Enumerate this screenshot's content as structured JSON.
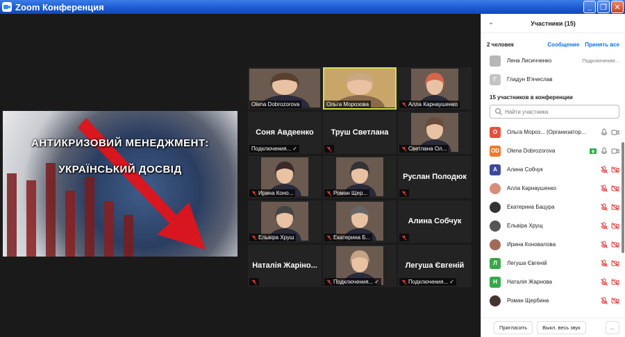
{
  "window": {
    "title": "Zoom Конференция"
  },
  "slide": {
    "line1": "АНТИКРИЗОВИЙ МЕНЕДЖМЕНТ:",
    "line2": "УКРАЇНСЬКИЙ ДОСВІД"
  },
  "tiles": [
    {
      "label": "Olena Dobrozorova",
      "photo": true,
      "mic_off": false,
      "check": false,
      "active": false
    },
    {
      "label": "Ольга Морозова",
      "photo": true,
      "mic_off": false,
      "check": false,
      "active": true
    },
    {
      "label": "Алла Карнаушенко",
      "photo": true,
      "mic_off": true,
      "check": false,
      "active": false
    },
    {
      "label": "Соня Авдеенко",
      "sub": "Подключения...",
      "photo": false,
      "mic_off": false,
      "check": true
    },
    {
      "label": "Труш Светлана",
      "photo": false,
      "mic_off": true,
      "check": false
    },
    {
      "label": "Светлана Ол...",
      "photo": true,
      "mic_off": true,
      "check": false
    },
    {
      "label": "Ирина Коно...",
      "photo": true,
      "mic_off": true,
      "check": false
    },
    {
      "label": "Роман Щер...",
      "photo": true,
      "mic_off": true,
      "check": false
    },
    {
      "label": "Руслан Полодюк",
      "photo": false,
      "mic_off": true,
      "check": false
    },
    {
      "label": "Ельвіра Хруш",
      "photo": true,
      "mic_off": true,
      "check": false
    },
    {
      "label": "Екатерина Б...",
      "photo": true,
      "mic_off": true,
      "check": false
    },
    {
      "label": "Алина Собчук",
      "photo": false,
      "mic_off": true,
      "check": false
    },
    {
      "label": "Наталія Жаріно...",
      "photo": false,
      "mic_off": true,
      "check": false
    },
    {
      "label": "Подключения...",
      "photo": true,
      "mic_off": true,
      "check": true
    },
    {
      "label": "Легуша Євгеній",
      "sub": "Подключения...",
      "photo": false,
      "mic_off": true,
      "check": true
    }
  ],
  "panel": {
    "title": "Участники (15)",
    "waiting_count": "2 человек",
    "message_label": "Сообщение",
    "admit_all_label": "Принять все",
    "waiting": [
      {
        "name": "Лена Лисичченко",
        "note": "Подключение...",
        "color": "#b7b7b7",
        "initial": ""
      },
      {
        "name": "Гладун В'ячеслав",
        "note": "",
        "color": "#c4c4c4",
        "initial": "Г"
      }
    ],
    "in_meeting_title": "15 участников в конференции",
    "search_placeholder": "Найти участника",
    "participants": [
      {
        "name": "Ольга Мороз... (Организатор...",
        "initial": "О",
        "color": "#e3503e",
        "mic": "on",
        "cam": "on"
      },
      {
        "name": "Olena Dobrozorova",
        "initial": "OD",
        "color": "#f07a2a",
        "mic": "on",
        "cam": "on",
        "share": true
      },
      {
        "name": "Алина Собчук",
        "initial": "А",
        "color": "#3b4a9c",
        "mic": "off",
        "cam": "off"
      },
      {
        "name": "Алла Карнаушенко",
        "initial": "",
        "color": "#d88c7a",
        "mic": "off",
        "cam": "off"
      },
      {
        "name": "Екатерина Бацура",
        "initial": "",
        "color": "#333333",
        "mic": "off",
        "cam": "off"
      },
      {
        "name": "Ельвіра Хрущ",
        "initial": "",
        "color": "#555555",
        "mic": "off",
        "cam": "off"
      },
      {
        "name": "Ирина Коновалова",
        "initial": "",
        "color": "#a06a5a",
        "mic": "off",
        "cam": "off"
      },
      {
        "name": "Легуша Євгеній",
        "initial": "Л",
        "color": "#3aa64a",
        "mic": "off",
        "cam": "off"
      },
      {
        "name": "Наталія Жарнова",
        "initial": "Н",
        "color": "#36a84a",
        "mic": "off",
        "cam": "off"
      },
      {
        "name": "Роман Щербина",
        "initial": "",
        "color": "#443333",
        "mic": "off",
        "cam": "off"
      }
    ],
    "invite_label": "Пригласить",
    "mute_all_label": "Выкл. весь звук",
    "more_label": "..."
  },
  "colors": {
    "accent": "#0e71eb",
    "mute_red": "#e53935",
    "titlebar": "#1c58d0"
  }
}
